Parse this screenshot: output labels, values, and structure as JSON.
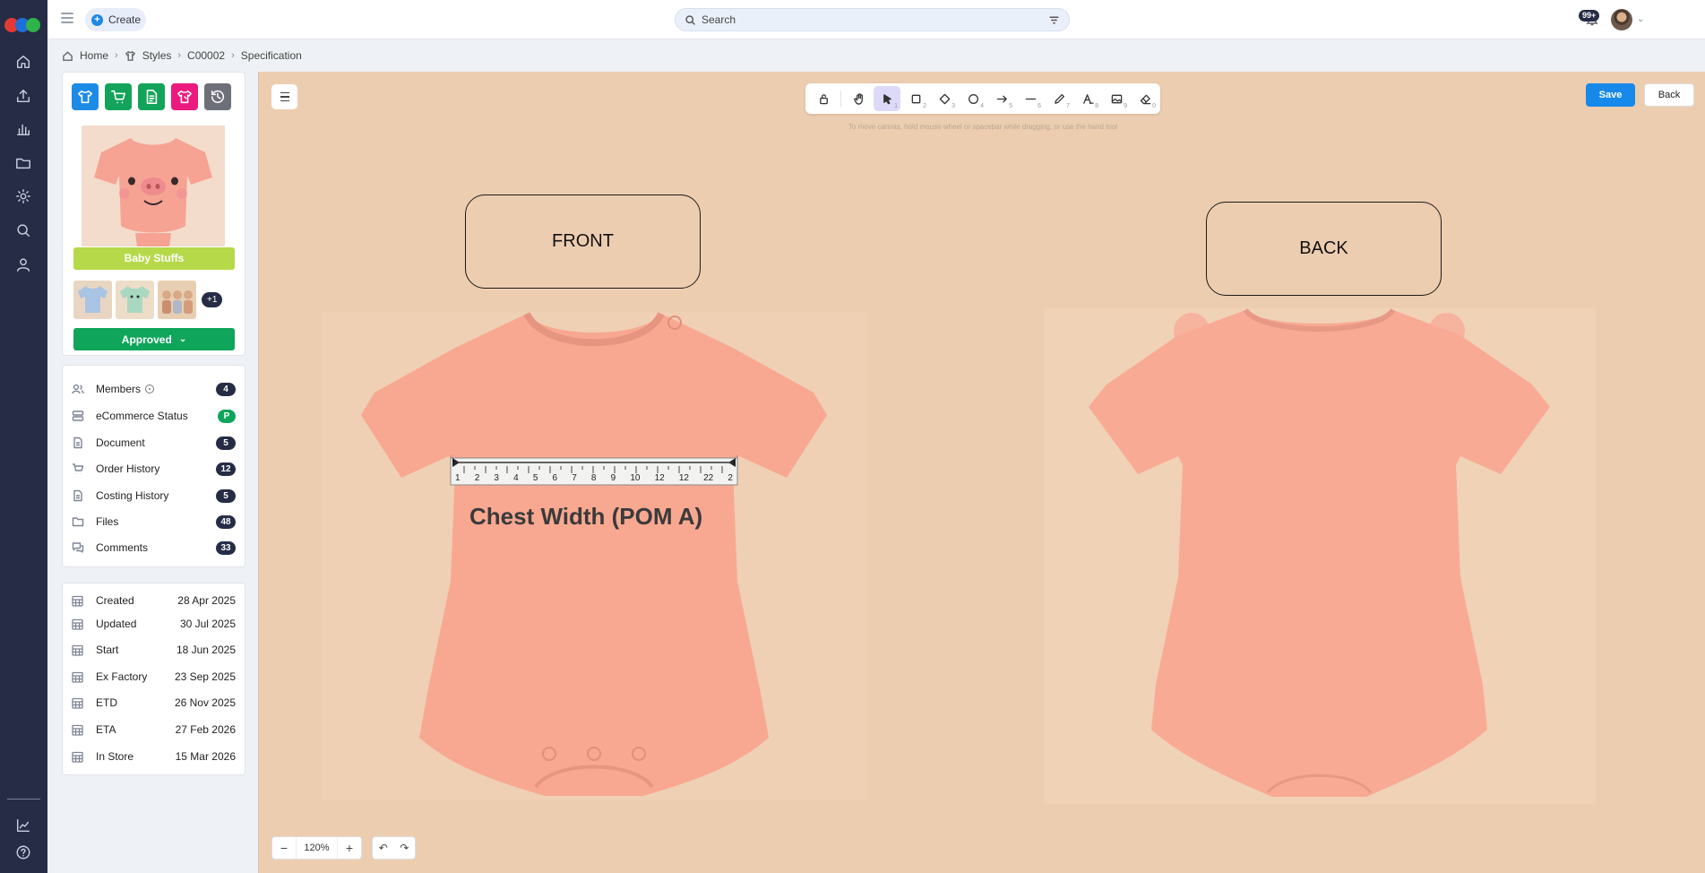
{
  "topbar": {
    "create_label": "Create",
    "search_placeholder": "Search",
    "notifications_count": "99+"
  },
  "breadcrumb": [
    "Home",
    "Styles",
    "C00002",
    "Specification"
  ],
  "product": {
    "tag": "Baby Stuffs",
    "more_images": "+1",
    "status": "Approved"
  },
  "menu": [
    {
      "label": "Members",
      "count": "4",
      "icon": "users-icon"
    },
    {
      "label": "eCommerce Status",
      "count": "P",
      "icon": "ecommerce-icon"
    },
    {
      "label": "Document",
      "count": "5",
      "icon": "document-icon"
    },
    {
      "label": "Order History",
      "count": "12",
      "icon": "cart-icon"
    },
    {
      "label": "Costing History",
      "count": "5",
      "icon": "costing-icon"
    },
    {
      "label": "Files",
      "count": "48",
      "icon": "folder-icon"
    },
    {
      "label": "Comments",
      "count": "33",
      "icon": "comments-icon"
    }
  ],
  "dates": [
    {
      "label": "Created",
      "value": "28 Apr 2025"
    },
    {
      "label": "Updated",
      "value": "30 Jul 2025"
    },
    {
      "label": "Start",
      "value": "18 Jun 2025"
    },
    {
      "label": "Ex Factory",
      "value": "23 Sep 2025"
    },
    {
      "label": "ETD",
      "value": "26 Nov 2025"
    },
    {
      "label": "ETA",
      "value": "27 Feb 2026"
    },
    {
      "label": "In Store",
      "value": "15 Mar 2026"
    }
  ],
  "canvas": {
    "hint": "To move canvas, hold mouse wheel or spacebar while dragging, or use the hand tool",
    "save_label": "Save",
    "back_label": "Back",
    "front_label": "FRONT",
    "back_view_label": "BACK",
    "chest_label": "Chest Width (POM A)",
    "ruler_numbers": [
      "1",
      "2",
      "3",
      "4",
      "5",
      "6",
      "7",
      "8",
      "9",
      "10",
      "12",
      "12",
      "22",
      "2"
    ],
    "zoom": "120%",
    "tool_keys": [
      "1",
      "2",
      "3",
      "4",
      "5",
      "6",
      "7",
      "8",
      "9",
      "0"
    ]
  },
  "colors": {
    "rail": "#262c45",
    "accent_blue": "#1789ea",
    "approved_green": "#0fa55a",
    "tag_lime": "#b6d94a",
    "canvas_bg": "#edcdb0",
    "garment": "#f6a88e"
  }
}
